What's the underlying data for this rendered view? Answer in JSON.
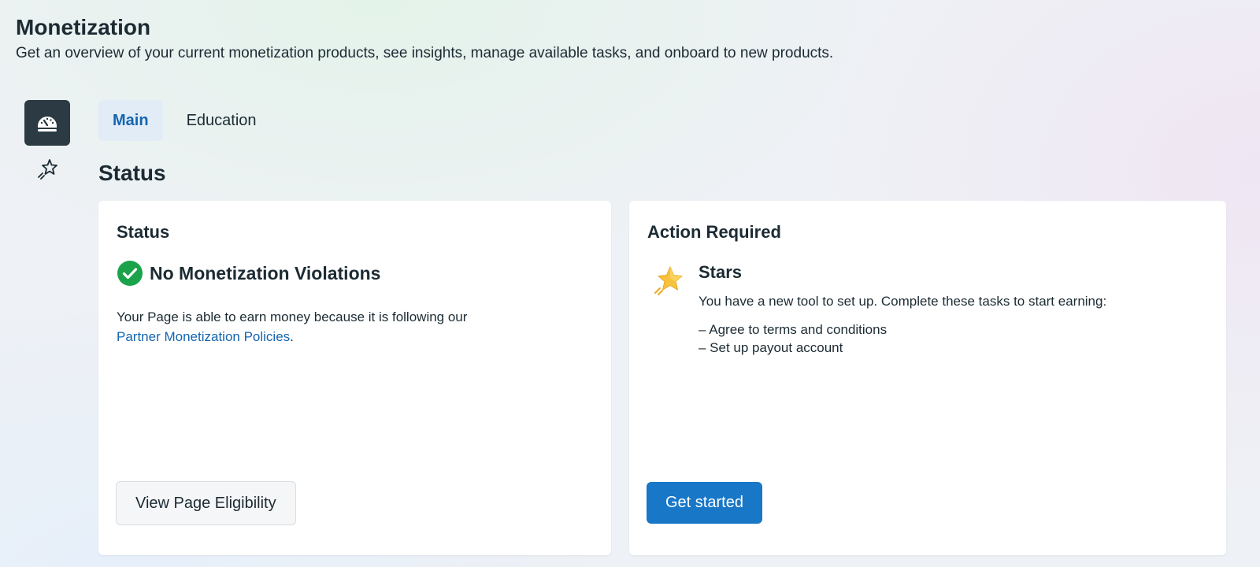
{
  "header": {
    "title": "Monetization",
    "subtitle": "Get an overview of your current monetization products, see insights, manage available tasks, and onboard to new products."
  },
  "rail": {
    "items": [
      {
        "icon": "dashboard-gauge-icon",
        "active": true
      },
      {
        "icon": "shooting-star-icon",
        "active": false
      }
    ]
  },
  "tabs": [
    {
      "label": "Main",
      "active": true
    },
    {
      "label": "Education",
      "active": false
    }
  ],
  "section_title": "Status",
  "status_card": {
    "title": "Status",
    "headline": "No Monetization Violations",
    "description": "Your Page is able to earn money because it is following our",
    "link_text": "Partner Monetization Policies",
    "after_link": ".",
    "button_label": "View Page Eligibility"
  },
  "action_card": {
    "title": "Action Required",
    "product_name": "Stars",
    "description": "You have a new tool to set up. Complete these tasks to start earning:",
    "tasks": [
      "– Agree to terms and conditions",
      "– Set up payout account"
    ],
    "button_label": "Get started"
  },
  "colors": {
    "accent": "#1877c7",
    "link": "#1565b0",
    "success": "#1aa34a",
    "star": "#f7c23e",
    "rail_active": "#2b3a43"
  }
}
